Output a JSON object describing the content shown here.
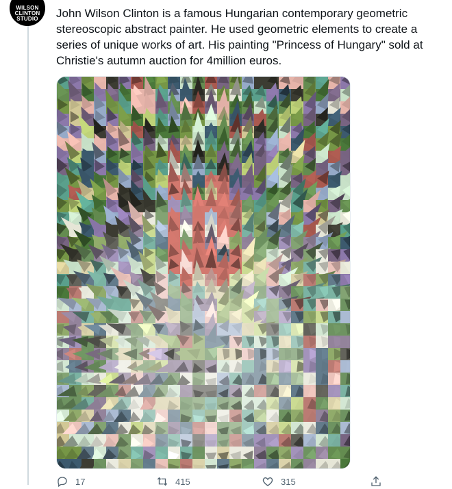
{
  "avatar": {
    "lines": [
      "WILSON",
      "CLINTON",
      "STUDIO"
    ]
  },
  "tweet": {
    "text": "John Wilson Clinton is a famous Hungarian contemporary geometric\nstereoscopic abstract painter. He used geometric elements to create a\nseries of unique works of art. His painting \"Princess of Hungary\" sold at\nChristie's autumn auction for 4million euros."
  },
  "actions": {
    "reply_count": "17",
    "retweet_count": "415",
    "like_count": "315"
  },
  "icons": {
    "reply": "reply-icon",
    "retweet": "retweet-icon",
    "like": "heart-icon",
    "share": "share-icon"
  }
}
